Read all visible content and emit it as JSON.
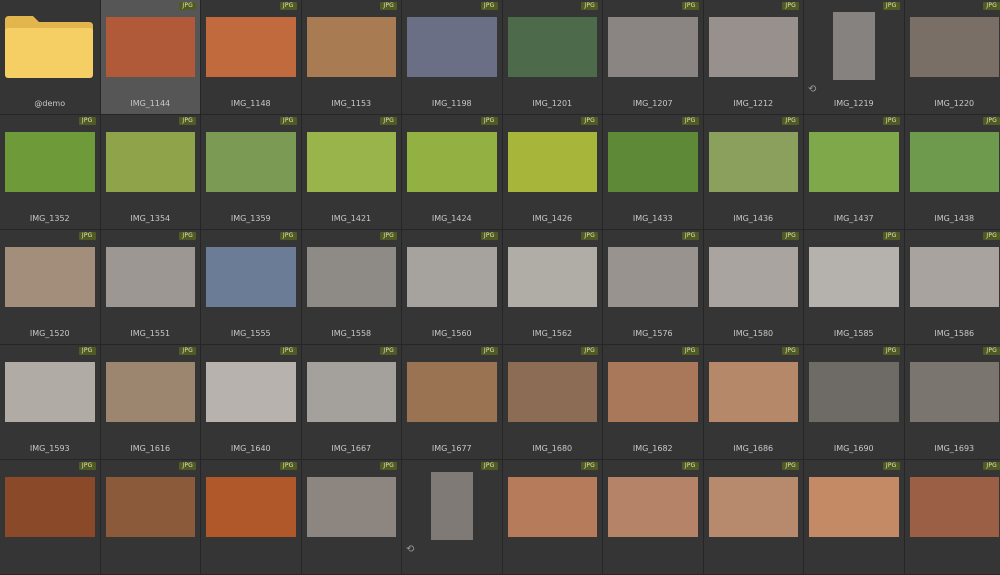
{
  "grid": {
    "badge_text": "JPG",
    "items": [
      {
        "label": "@demo",
        "type": "folder",
        "color": "#f5cf63"
      },
      {
        "label": "IMG_1144",
        "type": "image",
        "color": "#b05a3a",
        "selected": true,
        "badge": true
      },
      {
        "label": "IMG_1148",
        "type": "image",
        "color": "#c06a3e",
        "badge": true
      },
      {
        "label": "IMG_1153",
        "type": "image",
        "color": "#a97b52",
        "badge": true
      },
      {
        "label": "IMG_1198",
        "type": "image",
        "color": "#6a6f86",
        "badge": true
      },
      {
        "label": "IMG_1201",
        "type": "image",
        "color": "#4d6a4a",
        "badge": true
      },
      {
        "label": "IMG_1207",
        "type": "image",
        "color": "#8a8582",
        "badge": true
      },
      {
        "label": "IMG_1212",
        "type": "image",
        "color": "#97908c",
        "badge": true
      },
      {
        "label": "IMG_1219",
        "type": "image",
        "color": "#85827f",
        "badge": true,
        "portrait": true,
        "rotate": true
      },
      {
        "label": "IMG_1220",
        "type": "image",
        "color": "#7a6f66",
        "badge": true
      },
      {
        "label": "IMG_1352",
        "type": "image",
        "color": "#6f9a3a",
        "badge": true
      },
      {
        "label": "IMG_1354",
        "type": "image",
        "color": "#8ea34a",
        "badge": true
      },
      {
        "label": "IMG_1359",
        "type": "image",
        "color": "#7b9b54",
        "badge": true
      },
      {
        "label": "IMG_1421",
        "type": "image",
        "color": "#99b44a",
        "badge": true
      },
      {
        "label": "IMG_1424",
        "type": "image",
        "color": "#93b042",
        "badge": true
      },
      {
        "label": "IMG_1426",
        "type": "image",
        "color": "#a7b63b",
        "badge": true
      },
      {
        "label": "IMG_1433",
        "type": "image",
        "color": "#5e8a38",
        "badge": true
      },
      {
        "label": "IMG_1436",
        "type": "image",
        "color": "#8aa05c",
        "badge": true
      },
      {
        "label": "IMG_1437",
        "type": "image",
        "color": "#7fa84a",
        "badge": true
      },
      {
        "label": "IMG_1438",
        "type": "image",
        "color": "#6e9a4e",
        "badge": true
      },
      {
        "label": "IMG_1520",
        "type": "image",
        "color": "#a28e7a",
        "badge": true
      },
      {
        "label": "IMG_1551",
        "type": "image",
        "color": "#9c9792",
        "badge": true
      },
      {
        "label": "IMG_1555",
        "type": "image",
        "color": "#6a7c96",
        "badge": true
      },
      {
        "label": "IMG_1558",
        "type": "image",
        "color": "#8e8a85",
        "badge": true
      },
      {
        "label": "IMG_1560",
        "type": "image",
        "color": "#a6a29d",
        "badge": true
      },
      {
        "label": "IMG_1562",
        "type": "image",
        "color": "#b0aca6",
        "badge": true
      },
      {
        "label": "IMG_1576",
        "type": "image",
        "color": "#98938e",
        "badge": true
      },
      {
        "label": "IMG_1580",
        "type": "image",
        "color": "#a9a4a0",
        "badge": true
      },
      {
        "label": "IMG_1585",
        "type": "image",
        "color": "#b5b1ac",
        "badge": true
      },
      {
        "label": "IMG_1586",
        "type": "image",
        "color": "#a8a39e",
        "badge": true
      },
      {
        "label": "IMG_1593",
        "type": "image",
        "color": "#b0aba5",
        "badge": true
      },
      {
        "label": "IMG_1616",
        "type": "image",
        "color": "#9c8670",
        "badge": true
      },
      {
        "label": "IMG_1640",
        "type": "image",
        "color": "#b7b2ad",
        "badge": true
      },
      {
        "label": "IMG_1667",
        "type": "image",
        "color": "#a4a09b",
        "badge": true
      },
      {
        "label": "IMG_1677",
        "type": "image",
        "color": "#9a7352",
        "badge": true
      },
      {
        "label": "IMG_1680",
        "type": "image",
        "color": "#8c6c55",
        "badge": true
      },
      {
        "label": "IMG_1682",
        "type": "image",
        "color": "#a9785a",
        "badge": true
      },
      {
        "label": "IMG_1686",
        "type": "image",
        "color": "#b5886a",
        "badge": true
      },
      {
        "label": "IMG_1690",
        "type": "image",
        "color": "#6e6a66",
        "badge": true
      },
      {
        "label": "IMG_1693",
        "type": "image",
        "color": "#7a756f",
        "badge": true
      },
      {
        "label": "",
        "type": "image",
        "color": "#8a4a2a",
        "badge": true
      },
      {
        "label": "",
        "type": "image",
        "color": "#8a5a3a",
        "badge": true
      },
      {
        "label": "",
        "type": "image",
        "color": "#b0582a",
        "badge": true
      },
      {
        "label": "",
        "type": "image",
        "color": "#8c8580",
        "badge": true
      },
      {
        "label": "",
        "type": "image",
        "color": "#7f7a76",
        "badge": true,
        "portrait": true,
        "rotate": true
      },
      {
        "label": "",
        "type": "image",
        "color": "#b57b5a",
        "badge": true
      },
      {
        "label": "",
        "type": "image",
        "color": "#b58468",
        "badge": true
      },
      {
        "label": "",
        "type": "image",
        "color": "#b78a6e",
        "badge": true
      },
      {
        "label": "",
        "type": "image",
        "color": "#c48a66",
        "badge": true
      },
      {
        "label": "",
        "type": "image",
        "color": "#9a5f44",
        "badge": true
      }
    ]
  }
}
